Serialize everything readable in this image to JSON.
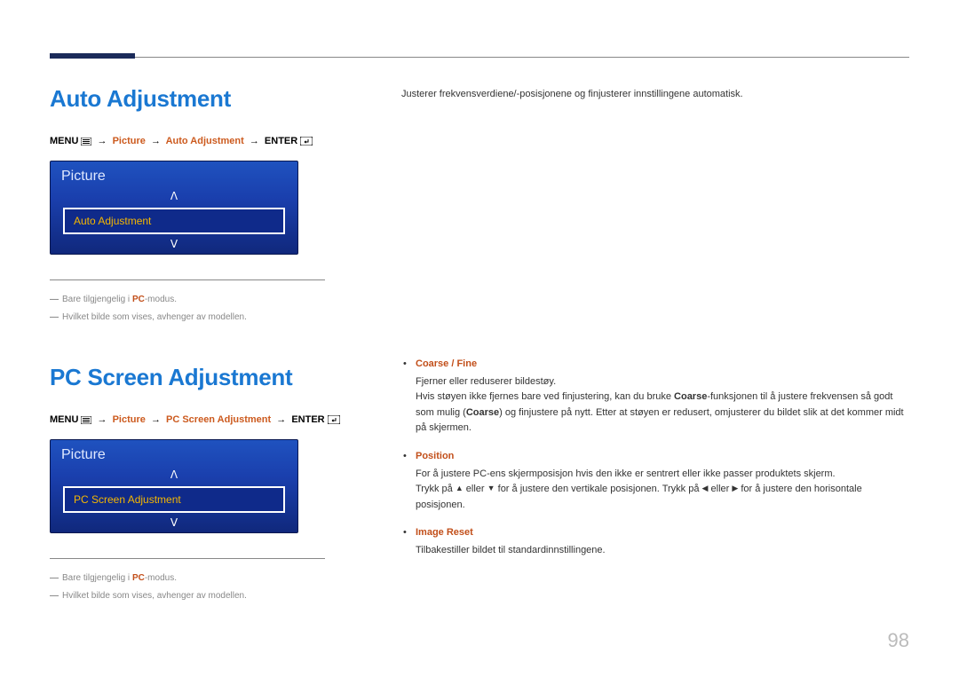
{
  "page_number": "98",
  "section1": {
    "heading": "Auto Adjustment",
    "breadcrumb": {
      "menu": "MENU",
      "arrow": "→",
      "p1": "Picture",
      "p2": "Auto Adjustment",
      "enter": "ENTER"
    },
    "osd": {
      "title": "Picture",
      "item": "Auto Adjustment"
    },
    "footnote1_a": "Bare tilgjengelig i ",
    "footnote1_b": "PC",
    "footnote1_c": "-modus.",
    "footnote2": "Hvilket bilde som vises, avhenger av modellen."
  },
  "right_intro": "Justerer frekvensverdiene/-posisjonene og finjusterer innstillingene automatisk.",
  "section2": {
    "heading": "PC Screen Adjustment",
    "breadcrumb": {
      "menu": "MENU",
      "arrow": "→",
      "p1": "Picture",
      "p2": "PC Screen Adjustment",
      "enter": "ENTER"
    },
    "osd": {
      "title": "Picture",
      "item": "PC Screen Adjustment"
    },
    "footnote1_a": "Bare tilgjengelig i ",
    "footnote1_b": "PC",
    "footnote1_c": "-modus.",
    "footnote2": "Hvilket bilde som vises, avhenger av modellen."
  },
  "bullets": {
    "b1_title": "Coarse / Fine",
    "b1_l1": "Fjerner eller reduserer bildestøy.",
    "b1_l2a": "Hvis støyen ikke fjernes bare ved finjustering, kan du bruke ",
    "b1_l2b": "Coarse",
    "b1_l2c": "-funksjonen til å justere frekvensen så godt som mulig (",
    "b1_l2d": "Coarse",
    "b1_l2e": ") og finjustere på nytt. Etter at støyen er redusert, omjusterer du bildet slik at det kommer midt på skjermen.",
    "b2_title": "Position",
    "b2_l1": "For å justere PC-ens skjermposisjon hvis den ikke er sentrert eller ikke passer produktets skjerm.",
    "b2_l2a": "Trykk på ",
    "b2_l2b": " eller ",
    "b2_l2c": " for å justere den vertikale posisjonen. Trykk på ",
    "b2_l2d": " eller ",
    "b2_l2e": " for å justere den horisontale posisjonen.",
    "b3_title": "Image Reset",
    "b3_l1": "Tilbakestiller bildet til standardinnstillingene."
  },
  "icons": {
    "up": "▲",
    "down": "▼",
    "left": "◀",
    "right": "▶",
    "osd_up": "ᐱ",
    "osd_down": "ᐯ"
  }
}
